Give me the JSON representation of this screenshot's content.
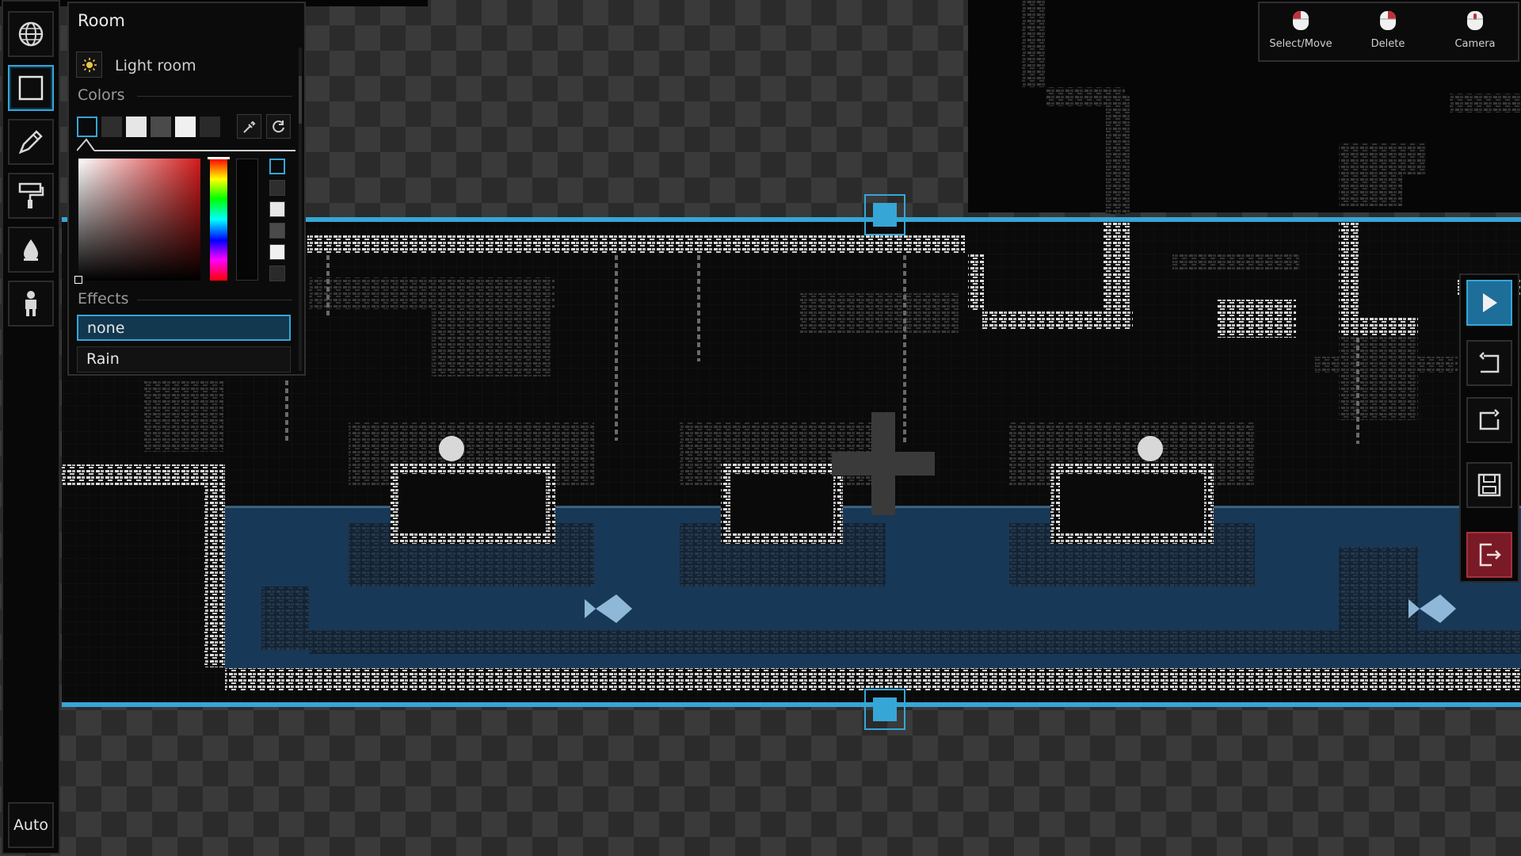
{
  "room_panel": {
    "title": "Room",
    "light_label": "Light room",
    "colors_heading": "Colors",
    "effects_heading": "Effects",
    "swatches": [
      "#0a0a0a",
      "#2e2e2e",
      "#e6e6e6",
      "#4a4a4a",
      "#f0f0f0",
      "#2a2a2a"
    ],
    "selected_swatch": 0,
    "palette_slots": [
      "#0a0a0a",
      "#2e2e2e",
      "#e6e6e6",
      "#4a4a4a",
      "#f0f0f0",
      "#2a2a2a"
    ],
    "effects": [
      "none",
      "Rain"
    ],
    "selected_effect": 0,
    "picker_base_color": "#d21b1b"
  },
  "toolbar": {
    "tools": [
      {
        "name": "world-icon",
        "active": false
      },
      {
        "name": "room-select-icon",
        "active": true
      },
      {
        "name": "pencil-icon",
        "active": false
      },
      {
        "name": "paint-roller-icon",
        "active": false
      },
      {
        "name": "paint-drop-icon",
        "active": false
      },
      {
        "name": "character-icon",
        "active": false
      }
    ],
    "auto_label": "Auto"
  },
  "mouse_hints": [
    {
      "label": "Select/Move",
      "button": "left"
    },
    {
      "label": "Delete",
      "button": "right"
    },
    {
      "label": "Camera",
      "button": "middle"
    }
  ],
  "actions": [
    {
      "name": "play-icon",
      "color": "#1e6e9a"
    },
    {
      "name": "undo-icon",
      "color": "#0d0d0d"
    },
    {
      "name": "redo-icon",
      "color": "#0d0d0d"
    },
    {
      "name": "save-icon",
      "color": "#0d0d0d"
    },
    {
      "name": "exit-icon",
      "color": "#7a1a26"
    }
  ],
  "colors": {
    "accent": "#36a6d6",
    "water": "#1a3d5e",
    "brick": "#d9d9d9"
  }
}
